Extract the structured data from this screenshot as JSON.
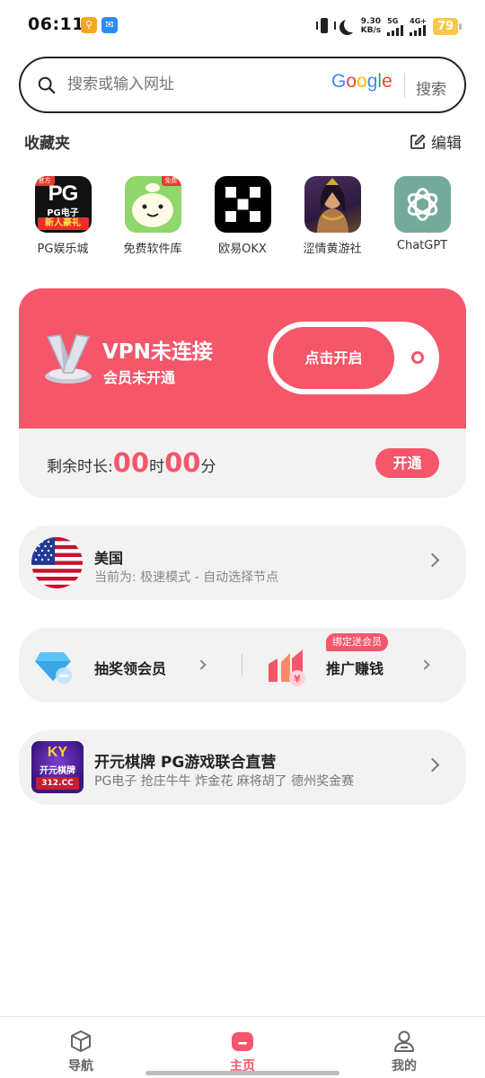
{
  "status_bar": {
    "time": "06:11",
    "app1_glyph": "⚲",
    "app2_glyph": "✉",
    "net_speed_value": "9.30",
    "net_speed_unit": "KB/s",
    "net1_label": "5G",
    "net2_label": "4G+",
    "battery": "79"
  },
  "search": {
    "placeholder": "搜索或输入网址",
    "engine_logo": "Google",
    "button_label": "搜索"
  },
  "favorites": {
    "title": "收藏夹",
    "edit_label": "编辑",
    "items": [
      {
        "label": "PG娱乐城",
        "icon_text_top": "PG",
        "icon_text_mid": "PG电子",
        "icon_text_bottom": "新人豪礼",
        "icon_corner": "官方"
      },
      {
        "label": "免费软件库",
        "icon_corner": "免费"
      },
      {
        "label": "欧易OKX"
      },
      {
        "label": "涩情黄游社"
      },
      {
        "label": "ChatGPT"
      }
    ]
  },
  "vpn": {
    "title": "VPN未连接",
    "subtitle": "会员未开通",
    "toggle_label": "点击开启",
    "remaining_label": "剩余时长:",
    "hours": "00",
    "hours_unit": "时",
    "minutes": "00",
    "minutes_unit": "分",
    "open_button": "开通"
  },
  "country": {
    "name": "美国",
    "mode": "当前为: 极速模式 - 自动选择节点"
  },
  "promo": {
    "left_label": "抽奖领会员",
    "right_label": "推广赚钱",
    "right_badge": "绑定送会员",
    "earn_icon_glyph": "¥"
  },
  "ad": {
    "icon_text_top": "KY",
    "icon_text_mid": "开元棋牌",
    "icon_text_bottom": "312.CC",
    "title": "开元棋牌 PG游戏联合直营",
    "subtitle": "PG电子 抢庄牛牛 炸金花 麻将胡了 德州奖金赛"
  },
  "bottom_nav": {
    "items": [
      {
        "label": "导航"
      },
      {
        "label": "主页"
      },
      {
        "label": "我的"
      }
    ],
    "active_index": 1
  },
  "colors": {
    "accent": "#f5566a",
    "card_bg": "#f2f2f2"
  }
}
